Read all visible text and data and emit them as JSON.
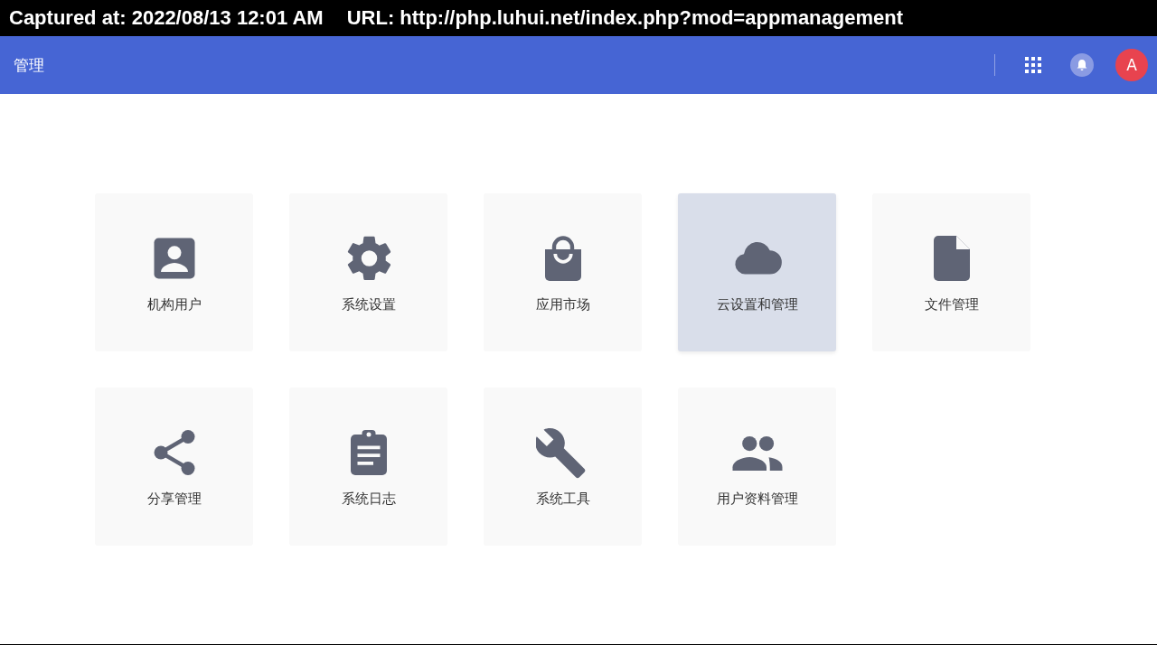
{
  "capture_banner": {
    "captured": "Captured at: 2022/08/13 12:01 AM",
    "url": "URL: http://php.luhui.net/index.php?mod=appmanagement"
  },
  "header": {
    "title": "管理",
    "avatar": "A"
  },
  "tiles": [
    {
      "label": "机构用户",
      "kind": "contact",
      "selected": false
    },
    {
      "label": "系统设置",
      "kind": "gear",
      "selected": false
    },
    {
      "label": "应用市场",
      "kind": "bag",
      "selected": false
    },
    {
      "label": "云设置和管理",
      "kind": "cloud",
      "selected": true
    },
    {
      "label": "文件管理",
      "kind": "file",
      "selected": false
    },
    {
      "label": "分享管理",
      "kind": "share",
      "selected": false
    },
    {
      "label": "系统日志",
      "kind": "clipboard",
      "selected": false
    },
    {
      "label": "系统工具",
      "kind": "wrench",
      "selected": false
    },
    {
      "label": "用户资料管理",
      "kind": "people",
      "selected": false
    }
  ]
}
